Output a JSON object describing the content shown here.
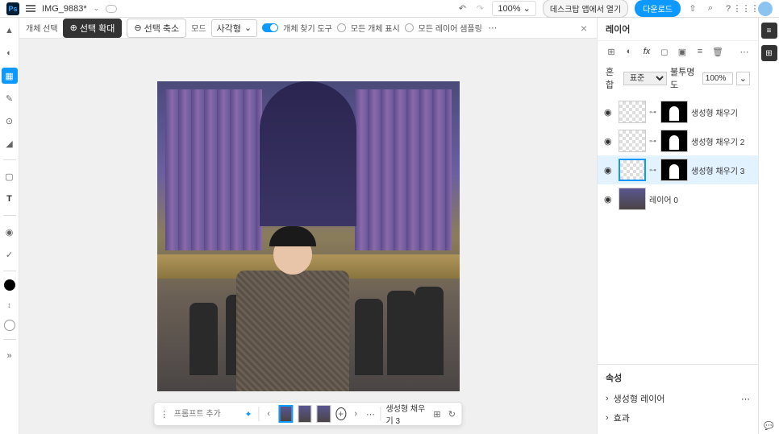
{
  "topbar": {
    "logo": "Ps",
    "filename": "IMG_9883*",
    "zoom": "100%",
    "desktop_btn": "데스크탑 앱에서 열기",
    "download": "다운로드"
  },
  "options": {
    "object_select": "개체 선택",
    "select_expand": "선택 확대",
    "select_shrink": "선택 축소",
    "mode_label": "모드",
    "mode_value": "사각형",
    "obj_finder": "개체 찾기 도구",
    "show_all": "모든 개체 표시",
    "sample_all": "모든 레이어 샘플링"
  },
  "floatbar": {
    "prompt_placeholder": "프롬프트 추가",
    "layer_name": "생성형 채우기 3"
  },
  "layers_panel": {
    "title": "레이어",
    "blend_label": "혼합",
    "blend_mode": "표준",
    "opacity_label": "불투명도",
    "opacity": "100%",
    "items": [
      {
        "name": "생성형 채우기"
      },
      {
        "name": "생성형 채우기 2"
      },
      {
        "name": "생성형 채우기 3"
      },
      {
        "name": "레이어 0"
      }
    ]
  },
  "properties": {
    "title": "속성",
    "row1": "생성형 레이어",
    "row2": "효과"
  }
}
